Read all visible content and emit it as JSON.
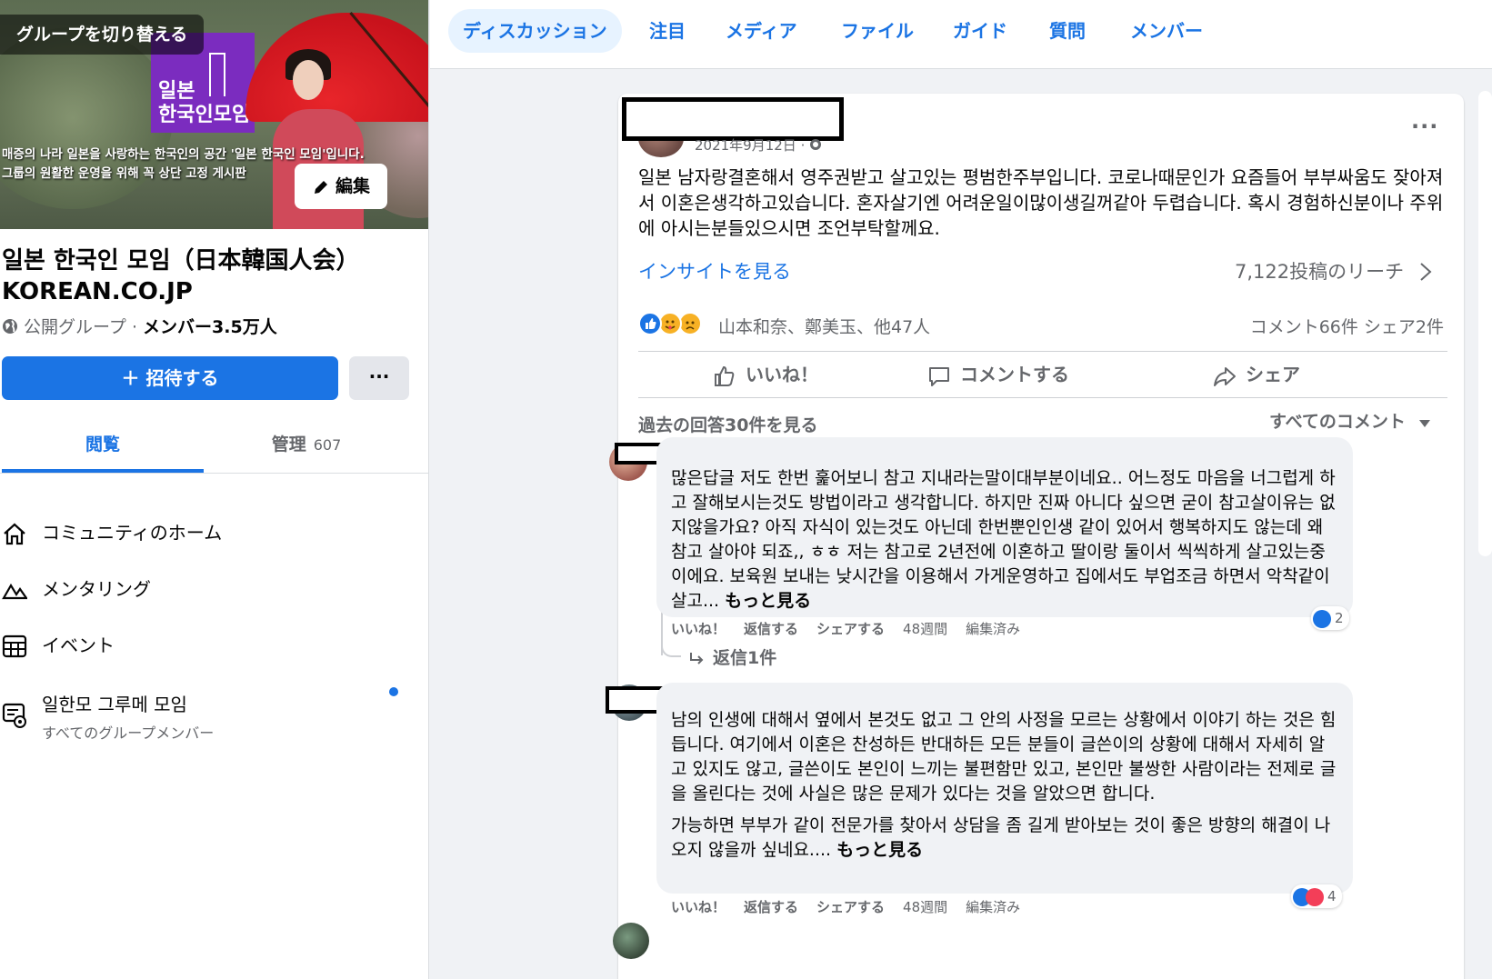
{
  "sidebar": {
    "switch_group": "グループを切り替える",
    "cover_logo_line1": "일본",
    "cover_logo_line2": "한국인모임",
    "cover_text_line1": "매증의 나라 일본을 사랑하는 한국인의 공간 '일본 한국인 모임'입니다.",
    "cover_text_line2": "그룹의 원활한 운영을 위해 꼭 상단 고정 게시판",
    "edit_label": "編集",
    "group_name_line1": "일본 한국인 모임（日本韓国人会）",
    "group_name_line2": "KOREAN.CO.JP",
    "group_type": "公開グループ · ",
    "member_count": "メンバー3.5万人",
    "invite_label": "＋ 招待する",
    "more_label": "···",
    "tab_browse": "閲覧",
    "tab_manage": "管理",
    "tab_manage_count": "607",
    "nav": {
      "home": "コミュニティのホーム",
      "mentoring": "メンタリング",
      "events": "イベント",
      "chat_title": "일한모 그루메 모임",
      "chat_sub": "すべてのグループメンバー"
    }
  },
  "topnav": {
    "tabs": [
      "ディスカッション",
      "注目",
      "メディア",
      "ファイル",
      "ガイド",
      "質問",
      "メンバー"
    ]
  },
  "post": {
    "date": "2021年9月12日 · ",
    "more": "···",
    "body": "일본 남자랑결혼해서 영주권받고 살고있는 평범한주부입니다. 코로나때문인가 요즘들어 부부싸움도 잦아져서 이혼은생각하고있습니다.  혼자살기엔 어려운일이많이생길꺼같아 두렵습니다.  혹시 경험하신분이나 주위에 아시는분들있으시면 조언부탁할께요.",
    "insight": "インサイトを見る",
    "reach": "7,122投稿のリーチ",
    "reactors": "山本和奈、鄭美玉、他47人",
    "counts": "コメント66件  シェア2件",
    "like": "いいね！",
    "comment": "コメントする",
    "share": "シェア",
    "prev_replies": "過去の回答30件を見る",
    "all_comments": "すべてのコメント"
  },
  "comments": [
    {
      "text": "많은답글 저도 한번 훑어보니 참고 지내라는말이대부분이네요.. 어느정도 마음을 너그럽게 하고 잘해보시는것도 방법이라고 생각합니다. 하지만 진짜 아니다 싶으면 굳이 참고살이유는 없지않을가요? 아직 자식이 있는것도 아닌데 한번뿐인인생 같이 있어서 행복하지도 않는데 왜 참고 살아야 되죠,, ㅎㅎ 저는 참고로 2년전에 이혼하고 딸이랑 둘이서 씩씩하게 살고있는중이에요. 보육원 보내는 낮시간을 이용해서 가게운영하고 집에서도 부업조금 하면서 악착같이 살고...",
      "more": "もっと見る",
      "like": "いいね！",
      "reply": "返信する",
      "share": "シェアする",
      "time": "48週間",
      "edited": "編集済み",
      "reactions": "2",
      "reply_count": "返信1件"
    },
    {
      "text": "남의 인생에 대해서 옆에서 본것도 없고 그 안의 사정을 모르는 상황에서 이야기 하는 것은 힘듭니다. 여기에서 이혼은 찬성하든 반대하든 모든 분들이 글쓴이의 상황에 대해서 자세히 알고 있지도 않고, 글쓴이도 본인이 느끼는 불편함만 있고, 본인만 불쌍한 사람이라는 전제로 글을 올린다는 것에 사실은 많은 문제가 있다는 것을 알았으면 합니다.",
      "text2": "가능하면 부부가 같이 전문가를 찾아서 상담을 좀 길게 받아보는 것이 좋은 방향의 해결이 나오지 않을까 싶네요....",
      "more": "もっと見る",
      "like": "いいね！",
      "reply": "返信する",
      "share": "シェアする",
      "time": "48週間",
      "edited": "編集済み",
      "reactions": "4"
    }
  ],
  "colors": {
    "accent": "#1b74e4",
    "love": "#f33e58",
    "haha": "#f7b125"
  }
}
